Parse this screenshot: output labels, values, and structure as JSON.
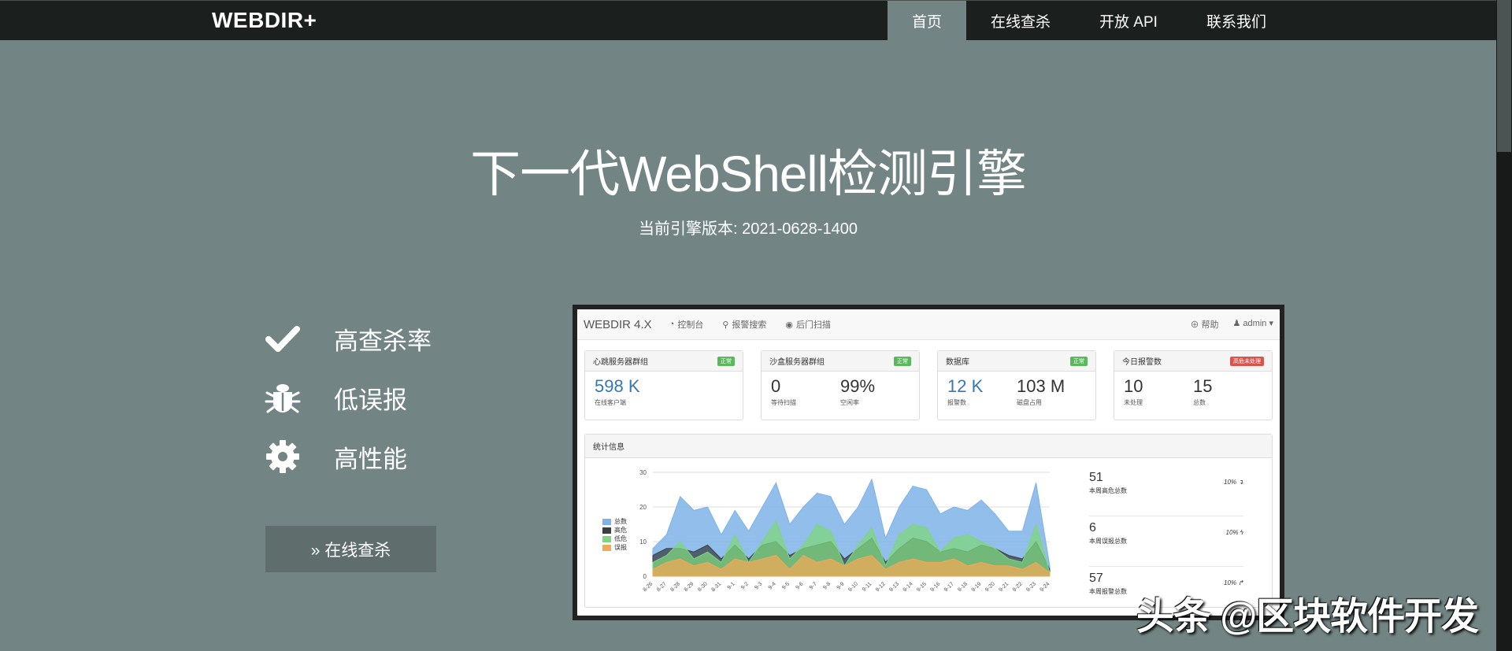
{
  "nav": {
    "brand": "WEBDIR+",
    "items": [
      {
        "label": "首页",
        "active": true
      },
      {
        "label": "在线查杀",
        "active": false
      },
      {
        "label": "开放 API",
        "active": false
      },
      {
        "label": "联系我们",
        "active": false
      }
    ]
  },
  "hero": {
    "title": "下一代WebShell检测引擎",
    "subtitle": "当前引擎版本: 2021-0628-1400"
  },
  "features": [
    {
      "icon": "checkmark-icon",
      "label": "高查杀率"
    },
    {
      "icon": "bug-icon",
      "label": "低误报"
    },
    {
      "icon": "gear-icon",
      "label": "高性能"
    }
  ],
  "cta": {
    "label": "» 在线查杀"
  },
  "dashboard": {
    "brand": "WEBDIR 4.X",
    "nav_links": [
      {
        "icon": "dashboard-icon",
        "label": "控制台"
      },
      {
        "icon": "search-icon",
        "label": "报警搜索"
      },
      {
        "icon": "eye-icon",
        "label": "后门扫描"
      }
    ],
    "help": "帮助",
    "user": "admin",
    "cards": [
      {
        "title": "心跳服务器群组",
        "badge": "正常",
        "badge_color": "#5cb85c",
        "stats": [
          {
            "value": "598 K",
            "label": "在线客户端",
            "highlight": true
          }
        ]
      },
      {
        "title": "沙盒服务器群组",
        "badge": "正常",
        "badge_color": "#5cb85c",
        "stats": [
          {
            "value": "0",
            "label": "等待扫描",
            "highlight": false
          },
          {
            "value": "99%",
            "label": "空闲率",
            "highlight": false
          }
        ]
      },
      {
        "title": "数据库",
        "badge": "正常",
        "badge_color": "#5cb85c",
        "stats": [
          {
            "value": "12 K",
            "label": "报警数",
            "highlight": true
          },
          {
            "value": "103 M",
            "label": "磁盘占用",
            "highlight": false
          }
        ]
      },
      {
        "title": "今日报警数",
        "badge": "高危未处理",
        "badge_color": "#d9534f",
        "stats": [
          {
            "value": "10",
            "label": "未处理",
            "highlight": false
          },
          {
            "value": "15",
            "label": "总数",
            "highlight": false
          }
        ]
      }
    ],
    "stats_title": "统计信息",
    "side_stats": [
      {
        "value": "51",
        "label": "本周高危总数",
        "change": "10%"
      },
      {
        "value": "6",
        "label": "本周误报总数",
        "change": "10%"
      },
      {
        "value": "57",
        "label": "本周报警总数",
        "change": "10%"
      }
    ]
  },
  "chart_data": {
    "type": "area",
    "x": [
      "8-26",
      "8-27",
      "8-28",
      "8-29",
      "8-30",
      "8-31",
      "9-1",
      "9-2",
      "9-3",
      "9-4",
      "9-5",
      "9-6",
      "9-7",
      "9-8",
      "9-9",
      "9-10",
      "9-11",
      "9-12",
      "9-13",
      "9-14",
      "9-15",
      "9-16",
      "9-17",
      "9-18",
      "9-19",
      "9-20",
      "9-21",
      "9-22",
      "9-23",
      "9-24"
    ],
    "ylim": [
      0,
      30
    ],
    "yticks": [
      0,
      10,
      20,
      30
    ],
    "series": [
      {
        "name": "总数",
        "color": "#7fb3e8",
        "values": [
          8,
          12,
          23,
          19,
          20,
          12,
          19,
          13,
          20,
          27,
          15,
          20,
          24,
          23,
          15,
          20,
          28,
          11,
          20,
          26,
          25,
          18,
          20,
          19,
          22,
          18,
          13,
          13,
          27,
          3
        ]
      },
      {
        "name": "高危",
        "color": "#3a3f44",
        "values": [
          6,
          8,
          8,
          7,
          9,
          5,
          9,
          5,
          9,
          10,
          6,
          8,
          9,
          10,
          5,
          8,
          11,
          4,
          8,
          11,
          10,
          7,
          8,
          7,
          9,
          8,
          6,
          5,
          10,
          2
        ]
      },
      {
        "name": "低危",
        "color": "#7dd67d",
        "values": [
          4,
          6,
          10,
          5,
          7,
          4,
          12,
          4,
          10,
          16,
          5,
          9,
          15,
          13,
          3,
          9,
          14,
          3,
          12,
          15,
          14,
          7,
          11,
          12,
          10,
          8,
          5,
          4,
          15,
          1
        ]
      },
      {
        "name": "误报",
        "color": "#f0a957",
        "values": [
          2,
          4,
          5,
          3,
          4,
          2,
          5,
          4,
          5,
          6,
          2,
          6,
          4,
          5,
          3,
          5,
          6,
          2,
          4,
          5,
          4,
          4,
          5,
          3,
          4,
          3,
          3,
          2,
          4,
          1
        ]
      }
    ]
  },
  "watermark": "头条 @区块软件开发"
}
